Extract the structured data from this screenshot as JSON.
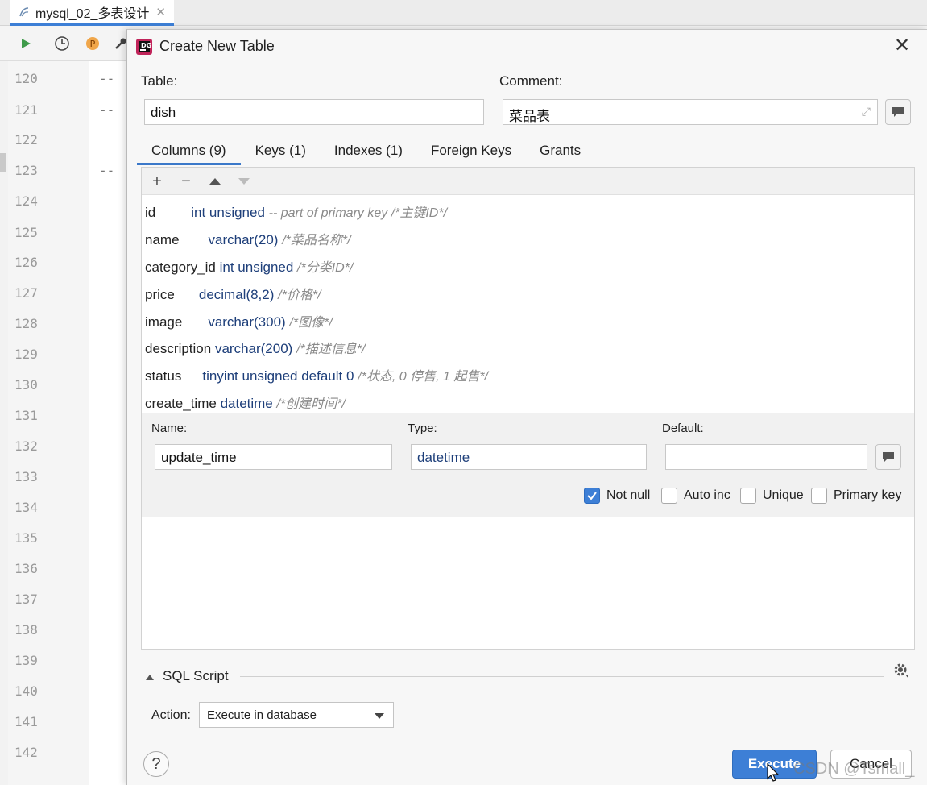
{
  "ide": {
    "tab_title": "mysql_02_多表设计",
    "line_numbers": [
      "120",
      "121",
      "122",
      "123",
      "124",
      "125",
      "126",
      "127",
      "128",
      "129",
      "130",
      "131",
      "132",
      "133",
      "134",
      "135",
      "136",
      "137",
      "138",
      "139",
      "140",
      "141",
      "142"
    ],
    "code_dash": "--"
  },
  "dialog": {
    "title": "Create New Table",
    "table_label": "Table:",
    "table_value": "dish",
    "comment_label": "Comment:",
    "comment_value": "菜品表",
    "tabs": [
      {
        "label": "Columns (9)",
        "active": true
      },
      {
        "label": "Keys (1)"
      },
      {
        "label": "Indexes (1)"
      },
      {
        "label": "Foreign Keys"
      },
      {
        "label": "Grants"
      }
    ],
    "columns": [
      {
        "name": "id",
        "type": "int unsigned",
        "extra": "-- part of primary key /*主键ID*/"
      },
      {
        "name": "name",
        "type": "varchar(20)",
        "extra": "/*菜品名称*/"
      },
      {
        "name": "category_id",
        "type": "int unsigned",
        "extra": "/*分类ID*/"
      },
      {
        "name": "price",
        "type": "decimal(8,2)",
        "extra": "/*价格*/"
      },
      {
        "name": "image",
        "type": "varchar(300)",
        "extra": "/*图像*/"
      },
      {
        "name": "description",
        "type": "varchar(200)",
        "extra": "/*描述信息*/"
      },
      {
        "name": "status",
        "type": "tinyint unsigned default 0",
        "extra": "/*状态, 0 停售, 1 起售*/"
      },
      {
        "name": "create_time",
        "type": "datetime",
        "extra": "/*创建时间*/"
      }
    ],
    "editor": {
      "name_label": "Name:",
      "name_value": "update_time",
      "type_label": "Type:",
      "type_value": "datetime",
      "default_label": "Default:",
      "default_value": "",
      "not_null_label": "Not null",
      "not_null_checked": true,
      "auto_inc_label": "Auto inc",
      "unique_label": "Unique",
      "primary_key_label": "Primary key"
    },
    "sql_script_label": "SQL Script",
    "action_label": "Action:",
    "action_value": "Execute in database",
    "help_label": "?",
    "execute_label": "Execute",
    "cancel_label": "Cancel"
  },
  "watermark": "CSDN @Tsmall_",
  "colors": {
    "accent": "#3d7fd6",
    "type_text": "#1e3f7a",
    "comment_text": "#8a8a8a"
  }
}
